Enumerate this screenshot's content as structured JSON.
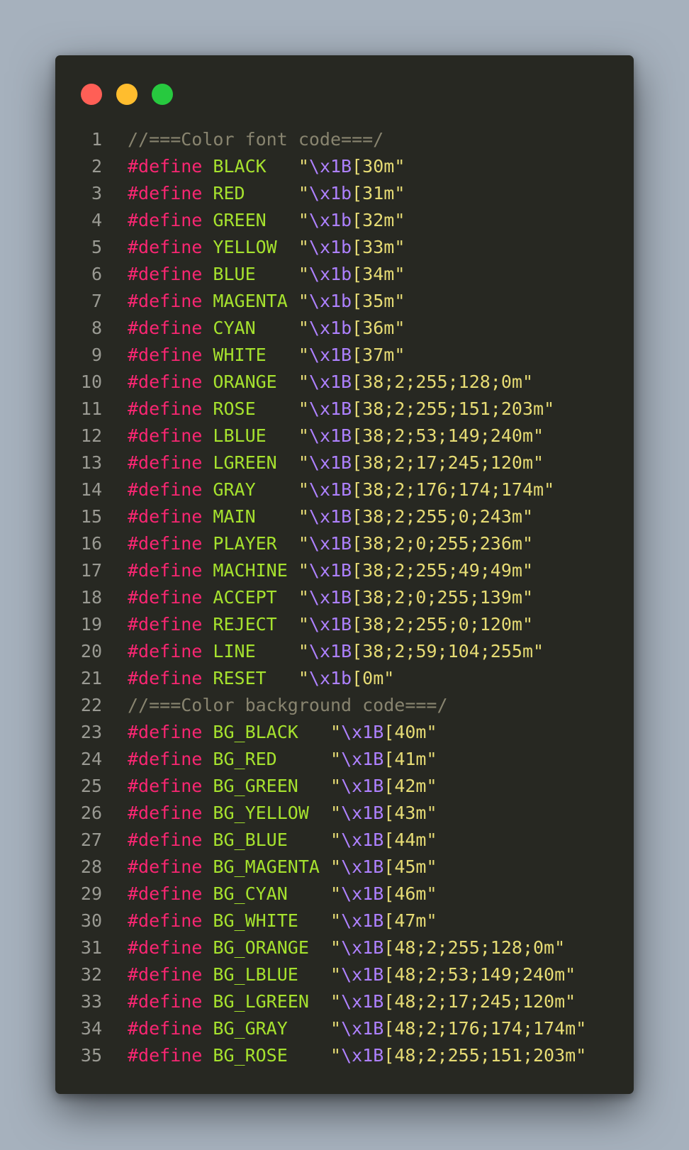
{
  "window_controls": {
    "close_color": "#ff5f56",
    "minimize_color": "#ffbd2e",
    "maximize_color": "#27c93f"
  },
  "theme": {
    "background": "#272822",
    "comment": "#88846f",
    "keyword": "#f92672",
    "name": "#a6e22e",
    "string": "#e6db74",
    "escape": "#ae81ff"
  },
  "code": {
    "lines": [
      {
        "n": "1",
        "tokens": [
          [
            "t-comment",
            "//===Color font code===/"
          ]
        ]
      },
      {
        "n": "2",
        "tokens": [
          [
            "t-kw",
            "#define"
          ],
          [
            "",
            " "
          ],
          [
            "t-name",
            "BLACK"
          ],
          [
            "",
            "   "
          ],
          [
            "t-str",
            "\""
          ],
          [
            "t-esc",
            "\\x1B"
          ],
          [
            "t-str",
            "[30m\""
          ]
        ]
      },
      {
        "n": "3",
        "tokens": [
          [
            "t-kw",
            "#define"
          ],
          [
            "",
            " "
          ],
          [
            "t-name",
            "RED"
          ],
          [
            "",
            "     "
          ],
          [
            "t-str",
            "\""
          ],
          [
            "t-esc",
            "\\x1b"
          ],
          [
            "t-str",
            "[31m\""
          ]
        ]
      },
      {
        "n": "4",
        "tokens": [
          [
            "t-kw",
            "#define"
          ],
          [
            "",
            " "
          ],
          [
            "t-name",
            "GREEN"
          ],
          [
            "",
            "   "
          ],
          [
            "t-str",
            "\""
          ],
          [
            "t-esc",
            "\\x1b"
          ],
          [
            "t-str",
            "[32m\""
          ]
        ]
      },
      {
        "n": "5",
        "tokens": [
          [
            "t-kw",
            "#define"
          ],
          [
            "",
            " "
          ],
          [
            "t-name",
            "YELLOW"
          ],
          [
            "",
            "  "
          ],
          [
            "t-str",
            "\""
          ],
          [
            "t-esc",
            "\\x1b"
          ],
          [
            "t-str",
            "[33m\""
          ]
        ]
      },
      {
        "n": "6",
        "tokens": [
          [
            "t-kw",
            "#define"
          ],
          [
            "",
            " "
          ],
          [
            "t-name",
            "BLUE"
          ],
          [
            "",
            "    "
          ],
          [
            "t-str",
            "\""
          ],
          [
            "t-esc",
            "\\x1b"
          ],
          [
            "t-str",
            "[34m\""
          ]
        ]
      },
      {
        "n": "7",
        "tokens": [
          [
            "t-kw",
            "#define"
          ],
          [
            "",
            " "
          ],
          [
            "t-name",
            "MAGENTA"
          ],
          [
            "",
            " "
          ],
          [
            "t-str",
            "\""
          ],
          [
            "t-esc",
            "\\x1b"
          ],
          [
            "t-str",
            "[35m\""
          ]
        ]
      },
      {
        "n": "8",
        "tokens": [
          [
            "t-kw",
            "#define"
          ],
          [
            "",
            " "
          ],
          [
            "t-name",
            "CYAN"
          ],
          [
            "",
            "    "
          ],
          [
            "t-str",
            "\""
          ],
          [
            "t-esc",
            "\\x1b"
          ],
          [
            "t-str",
            "[36m\""
          ]
        ]
      },
      {
        "n": "9",
        "tokens": [
          [
            "t-kw",
            "#define"
          ],
          [
            "",
            " "
          ],
          [
            "t-name",
            "WHITE"
          ],
          [
            "",
            "   "
          ],
          [
            "t-str",
            "\""
          ],
          [
            "t-esc",
            "\\x1B"
          ],
          [
            "t-str",
            "[37m\""
          ]
        ]
      },
      {
        "n": "10",
        "tokens": [
          [
            "t-kw",
            "#define"
          ],
          [
            "",
            " "
          ],
          [
            "t-name",
            "ORANGE"
          ],
          [
            "",
            "  "
          ],
          [
            "t-str",
            "\""
          ],
          [
            "t-esc",
            "\\x1B"
          ],
          [
            "t-str",
            "[38;2;255;128;0m\""
          ]
        ]
      },
      {
        "n": "11",
        "tokens": [
          [
            "t-kw",
            "#define"
          ],
          [
            "",
            " "
          ],
          [
            "t-name",
            "ROSE"
          ],
          [
            "",
            "    "
          ],
          [
            "t-str",
            "\""
          ],
          [
            "t-esc",
            "\\x1B"
          ],
          [
            "t-str",
            "[38;2;255;151;203m\""
          ]
        ]
      },
      {
        "n": "12",
        "tokens": [
          [
            "t-kw",
            "#define"
          ],
          [
            "",
            " "
          ],
          [
            "t-name",
            "LBLUE"
          ],
          [
            "",
            "   "
          ],
          [
            "t-str",
            "\""
          ],
          [
            "t-esc",
            "\\x1B"
          ],
          [
            "t-str",
            "[38;2;53;149;240m\""
          ]
        ]
      },
      {
        "n": "13",
        "tokens": [
          [
            "t-kw",
            "#define"
          ],
          [
            "",
            " "
          ],
          [
            "t-name",
            "LGREEN"
          ],
          [
            "",
            "  "
          ],
          [
            "t-str",
            "\""
          ],
          [
            "t-esc",
            "\\x1B"
          ],
          [
            "t-str",
            "[38;2;17;245;120m\""
          ]
        ]
      },
      {
        "n": "14",
        "tokens": [
          [
            "t-kw",
            "#define"
          ],
          [
            "",
            " "
          ],
          [
            "t-name",
            "GRAY"
          ],
          [
            "",
            "    "
          ],
          [
            "t-str",
            "\""
          ],
          [
            "t-esc",
            "\\x1B"
          ],
          [
            "t-str",
            "[38;2;176;174;174m\""
          ]
        ]
      },
      {
        "n": "15",
        "tokens": [
          [
            "t-kw",
            "#define"
          ],
          [
            "",
            " "
          ],
          [
            "t-name",
            "MAIN"
          ],
          [
            "",
            "    "
          ],
          [
            "t-str",
            "\""
          ],
          [
            "t-esc",
            "\\x1B"
          ],
          [
            "t-str",
            "[38;2;255;0;243m\""
          ]
        ]
      },
      {
        "n": "16",
        "tokens": [
          [
            "t-kw",
            "#define"
          ],
          [
            "",
            " "
          ],
          [
            "t-name",
            "PLAYER"
          ],
          [
            "",
            "  "
          ],
          [
            "t-str",
            "\""
          ],
          [
            "t-esc",
            "\\x1B"
          ],
          [
            "t-str",
            "[38;2;0;255;236m\""
          ]
        ]
      },
      {
        "n": "17",
        "tokens": [
          [
            "t-kw",
            "#define"
          ],
          [
            "",
            " "
          ],
          [
            "t-name",
            "MACHINE"
          ],
          [
            "",
            " "
          ],
          [
            "t-str",
            "\""
          ],
          [
            "t-esc",
            "\\x1B"
          ],
          [
            "t-str",
            "[38;2;255;49;49m\""
          ]
        ]
      },
      {
        "n": "18",
        "tokens": [
          [
            "t-kw",
            "#define"
          ],
          [
            "",
            " "
          ],
          [
            "t-name",
            "ACCEPT"
          ],
          [
            "",
            "  "
          ],
          [
            "t-str",
            "\""
          ],
          [
            "t-esc",
            "\\x1B"
          ],
          [
            "t-str",
            "[38;2;0;255;139m\""
          ]
        ]
      },
      {
        "n": "19",
        "tokens": [
          [
            "t-kw",
            "#define"
          ],
          [
            "",
            " "
          ],
          [
            "t-name",
            "REJECT"
          ],
          [
            "",
            "  "
          ],
          [
            "t-str",
            "\""
          ],
          [
            "t-esc",
            "\\x1B"
          ],
          [
            "t-str",
            "[38;2;255;0;120m\""
          ]
        ]
      },
      {
        "n": "20",
        "tokens": [
          [
            "t-kw",
            "#define"
          ],
          [
            "",
            " "
          ],
          [
            "t-name",
            "LINE"
          ],
          [
            "",
            "    "
          ],
          [
            "t-str",
            "\""
          ],
          [
            "t-esc",
            "\\x1B"
          ],
          [
            "t-str",
            "[38;2;59;104;255m\""
          ]
        ]
      },
      {
        "n": "21",
        "tokens": [
          [
            "t-kw",
            "#define"
          ],
          [
            "",
            " "
          ],
          [
            "t-name",
            "RESET"
          ],
          [
            "",
            "   "
          ],
          [
            "t-str",
            "\""
          ],
          [
            "t-esc",
            "\\x1b"
          ],
          [
            "t-str",
            "[0m\""
          ]
        ]
      },
      {
        "n": "22",
        "tokens": [
          [
            "t-comment",
            "//===Color background code===/"
          ]
        ]
      },
      {
        "n": "23",
        "tokens": [
          [
            "t-kw",
            "#define"
          ],
          [
            "",
            " "
          ],
          [
            "t-name",
            "BG_BLACK"
          ],
          [
            "",
            "   "
          ],
          [
            "t-str",
            "\""
          ],
          [
            "t-esc",
            "\\x1B"
          ],
          [
            "t-str",
            "[40m\""
          ]
        ]
      },
      {
        "n": "24",
        "tokens": [
          [
            "t-kw",
            "#define"
          ],
          [
            "",
            " "
          ],
          [
            "t-name",
            "BG_RED"
          ],
          [
            "",
            "     "
          ],
          [
            "t-str",
            "\""
          ],
          [
            "t-esc",
            "\\x1B"
          ],
          [
            "t-str",
            "[41m\""
          ]
        ]
      },
      {
        "n": "25",
        "tokens": [
          [
            "t-kw",
            "#define"
          ],
          [
            "",
            " "
          ],
          [
            "t-name",
            "BG_GREEN"
          ],
          [
            "",
            "   "
          ],
          [
            "t-str",
            "\""
          ],
          [
            "t-esc",
            "\\x1B"
          ],
          [
            "t-str",
            "[42m\""
          ]
        ]
      },
      {
        "n": "26",
        "tokens": [
          [
            "t-kw",
            "#define"
          ],
          [
            "",
            " "
          ],
          [
            "t-name",
            "BG_YELLOW"
          ],
          [
            "",
            "  "
          ],
          [
            "t-str",
            "\""
          ],
          [
            "t-esc",
            "\\x1B"
          ],
          [
            "t-str",
            "[43m\""
          ]
        ]
      },
      {
        "n": "27",
        "tokens": [
          [
            "t-kw",
            "#define"
          ],
          [
            "",
            " "
          ],
          [
            "t-name",
            "BG_BLUE"
          ],
          [
            "",
            "    "
          ],
          [
            "t-str",
            "\""
          ],
          [
            "t-esc",
            "\\x1B"
          ],
          [
            "t-str",
            "[44m\""
          ]
        ]
      },
      {
        "n": "28",
        "tokens": [
          [
            "t-kw",
            "#define"
          ],
          [
            "",
            " "
          ],
          [
            "t-name",
            "BG_MAGENTA"
          ],
          [
            "",
            " "
          ],
          [
            "t-str",
            "\""
          ],
          [
            "t-esc",
            "\\x1B"
          ],
          [
            "t-str",
            "[45m\""
          ]
        ]
      },
      {
        "n": "29",
        "tokens": [
          [
            "t-kw",
            "#define"
          ],
          [
            "",
            " "
          ],
          [
            "t-name",
            "BG_CYAN"
          ],
          [
            "",
            "    "
          ],
          [
            "t-str",
            "\""
          ],
          [
            "t-esc",
            "\\x1B"
          ],
          [
            "t-str",
            "[46m\""
          ]
        ]
      },
      {
        "n": "30",
        "tokens": [
          [
            "t-kw",
            "#define"
          ],
          [
            "",
            " "
          ],
          [
            "t-name",
            "BG_WHITE"
          ],
          [
            "",
            "   "
          ],
          [
            "t-str",
            "\""
          ],
          [
            "t-esc",
            "\\x1B"
          ],
          [
            "t-str",
            "[47m\""
          ]
        ]
      },
      {
        "n": "31",
        "tokens": [
          [
            "t-kw",
            "#define"
          ],
          [
            "",
            " "
          ],
          [
            "t-name",
            "BG_ORANGE"
          ],
          [
            "",
            "  "
          ],
          [
            "t-str",
            "\""
          ],
          [
            "t-esc",
            "\\x1B"
          ],
          [
            "t-str",
            "[48;2;255;128;0m\""
          ]
        ]
      },
      {
        "n": "32",
        "tokens": [
          [
            "t-kw",
            "#define"
          ],
          [
            "",
            " "
          ],
          [
            "t-name",
            "BG_LBLUE"
          ],
          [
            "",
            "   "
          ],
          [
            "t-str",
            "\""
          ],
          [
            "t-esc",
            "\\x1B"
          ],
          [
            "t-str",
            "[48;2;53;149;240m\""
          ]
        ]
      },
      {
        "n": "33",
        "tokens": [
          [
            "t-kw",
            "#define"
          ],
          [
            "",
            " "
          ],
          [
            "t-name",
            "BG_LGREEN"
          ],
          [
            "",
            "  "
          ],
          [
            "t-str",
            "\""
          ],
          [
            "t-esc",
            "\\x1B"
          ],
          [
            "t-str",
            "[48;2;17;245;120m\""
          ]
        ]
      },
      {
        "n": "34",
        "tokens": [
          [
            "t-kw",
            "#define"
          ],
          [
            "",
            " "
          ],
          [
            "t-name",
            "BG_GRAY"
          ],
          [
            "",
            "    "
          ],
          [
            "t-str",
            "\""
          ],
          [
            "t-esc",
            "\\x1B"
          ],
          [
            "t-str",
            "[48;2;176;174;174m\""
          ]
        ]
      },
      {
        "n": "35",
        "tokens": [
          [
            "t-kw",
            "#define"
          ],
          [
            "",
            " "
          ],
          [
            "t-name",
            "BG_ROSE"
          ],
          [
            "",
            "    "
          ],
          [
            "t-str",
            "\""
          ],
          [
            "t-esc",
            "\\x1B"
          ],
          [
            "t-str",
            "[48;2;255;151;203m\""
          ]
        ]
      }
    ]
  }
}
